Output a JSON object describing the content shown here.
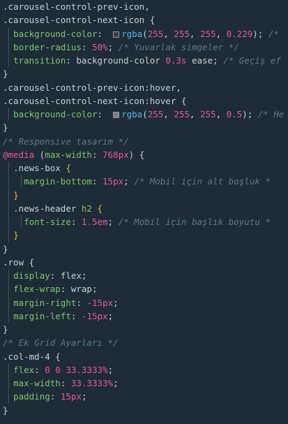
{
  "colors": {
    "background": "#1d2c36",
    "selector": "#c8d3d9",
    "property": "#7fc76f",
    "number": "#e9589a",
    "function": "#52b4e6",
    "brace": "#e3bf3d",
    "comment": "#5f7a87"
  },
  "lines": [
    {
      "t": [
        {
          "k": "sel",
          "v": ".carousel-control-prev-icon,"
        }
      ]
    },
    {
      "t": [
        {
          "k": "sel",
          "v": ".carousel-control-next-icon "
        },
        {
          "k": "punct",
          "v": "{"
        }
      ]
    },
    {
      "i": 1,
      "t": [
        {
          "k": "prop",
          "v": "background-color"
        },
        {
          "k": "punct",
          "v": ":  "
        },
        {
          "k": "swatch",
          "c": "#3a3e42"
        },
        {
          "k": "fn",
          "v": "rgba"
        },
        {
          "k": "punct",
          "v": "("
        },
        {
          "k": "num",
          "v": "255"
        },
        {
          "k": "punct",
          "v": ", "
        },
        {
          "k": "num",
          "v": "255"
        },
        {
          "k": "punct",
          "v": ", "
        },
        {
          "k": "num",
          "v": "255"
        },
        {
          "k": "punct",
          "v": ", "
        },
        {
          "k": "num",
          "v": "0.229"
        },
        {
          "k": "punct",
          "v": "); "
        },
        {
          "k": "cm",
          "v": "/* "
        }
      ]
    },
    {
      "i": 1,
      "t": [
        {
          "k": "prop",
          "v": "border-radius"
        },
        {
          "k": "punct",
          "v": ": "
        },
        {
          "k": "num",
          "v": "50"
        },
        {
          "k": "unit",
          "v": "%"
        },
        {
          "k": "punct",
          "v": "; "
        },
        {
          "k": "cm",
          "v": "/* Yuvarlak simgeler */"
        }
      ]
    },
    {
      "i": 1,
      "t": [
        {
          "k": "prop",
          "v": "transition"
        },
        {
          "k": "punct",
          "v": ": "
        },
        {
          "k": "text",
          "v": "background-color "
        },
        {
          "k": "num",
          "v": "0.3"
        },
        {
          "k": "unit",
          "v": "s"
        },
        {
          "k": "text",
          "v": " ease"
        },
        {
          "k": "punct",
          "v": "; "
        },
        {
          "k": "cm",
          "v": "/* Geçiş ef"
        }
      ]
    },
    {
      "t": [
        {
          "k": "punct",
          "v": "}"
        }
      ]
    },
    {
      "t": [
        {
          "k": "sel",
          "v": ".carousel-control-prev-icon:hover,"
        }
      ]
    },
    {
      "t": [
        {
          "k": "sel",
          "v": ".carousel-control-next-icon:hover "
        },
        {
          "k": "punct",
          "v": "{"
        }
      ]
    },
    {
      "i": 1,
      "t": [
        {
          "k": "prop",
          "v": "background-color"
        },
        {
          "k": "punct",
          "v": ":  "
        },
        {
          "k": "swatch",
          "c": "#7d8084"
        },
        {
          "k": "fn",
          "v": "rgba"
        },
        {
          "k": "punct",
          "v": "("
        },
        {
          "k": "num",
          "v": "255"
        },
        {
          "k": "punct",
          "v": ", "
        },
        {
          "k": "num",
          "v": "255"
        },
        {
          "k": "punct",
          "v": ", "
        },
        {
          "k": "num",
          "v": "255"
        },
        {
          "k": "punct",
          "v": ", "
        },
        {
          "k": "num",
          "v": "0.5"
        },
        {
          "k": "punct",
          "v": "); "
        },
        {
          "k": "cm",
          "v": "/* He"
        }
      ]
    },
    {
      "t": [
        {
          "k": "punct",
          "v": "}"
        }
      ]
    },
    {
      "t": [
        {
          "k": "cm",
          "v": "/* Responsive tasarım */"
        }
      ]
    },
    {
      "t": [
        {
          "k": "at",
          "v": "@media"
        },
        {
          "k": "punct",
          "v": " ("
        },
        {
          "k": "prop",
          "v": "max-width"
        },
        {
          "k": "punct",
          "v": ": "
        },
        {
          "k": "num",
          "v": "768"
        },
        {
          "k": "unit",
          "v": "px"
        },
        {
          "k": "punct",
          "v": ") {"
        }
      ]
    },
    {
      "i": 1,
      "t": [
        {
          "k": "sel",
          "v": ".news-box "
        },
        {
          "k": "brace",
          "v": "{"
        }
      ]
    },
    {
      "i": 2,
      "t": [
        {
          "k": "prop",
          "v": "margin-bottom"
        },
        {
          "k": "punct",
          "v": ": "
        },
        {
          "k": "num",
          "v": "15"
        },
        {
          "k": "unit",
          "v": "px"
        },
        {
          "k": "punct",
          "v": "; "
        },
        {
          "k": "cm",
          "v": "/* Mobil için alt boşluk *"
        }
      ]
    },
    {
      "i": 1,
      "t": [
        {
          "k": "brace",
          "v": "}"
        }
      ]
    },
    {
      "i": 1,
      "t": [
        {
          "k": "sel",
          "v": ".news-header "
        },
        {
          "k": "prop",
          "v": "h2"
        },
        {
          "k": "sel",
          "v": " "
        },
        {
          "k": "brace",
          "v": "{"
        }
      ]
    },
    {
      "i": 2,
      "t": [
        {
          "k": "prop",
          "v": "font-size"
        },
        {
          "k": "punct",
          "v": ": "
        },
        {
          "k": "num",
          "v": "1.5"
        },
        {
          "k": "unit",
          "v": "em"
        },
        {
          "k": "punct",
          "v": "; "
        },
        {
          "k": "cm",
          "v": "/* Mobil için başlık boyutu *"
        }
      ]
    },
    {
      "i": 1,
      "t": [
        {
          "k": "brace",
          "v": "}"
        }
      ]
    },
    {
      "t": [
        {
          "k": "punct",
          "v": "}"
        }
      ]
    },
    {
      "t": [
        {
          "k": "sel",
          "v": ".row "
        },
        {
          "k": "punct",
          "v": "{"
        }
      ]
    },
    {
      "i": 1,
      "t": [
        {
          "k": "prop",
          "v": "display"
        },
        {
          "k": "punct",
          "v": ": "
        },
        {
          "k": "text",
          "v": "flex"
        },
        {
          "k": "punct",
          "v": ";"
        }
      ]
    },
    {
      "i": 1,
      "t": [
        {
          "k": "prop",
          "v": "flex-wrap"
        },
        {
          "k": "punct",
          "v": ": "
        },
        {
          "k": "text",
          "v": "wrap"
        },
        {
          "k": "punct",
          "v": ";"
        }
      ]
    },
    {
      "i": 1,
      "t": [
        {
          "k": "prop",
          "v": "margin-right"
        },
        {
          "k": "punct",
          "v": ": "
        },
        {
          "k": "num",
          "v": "-15"
        },
        {
          "k": "unit",
          "v": "px"
        },
        {
          "k": "punct",
          "v": ";"
        }
      ]
    },
    {
      "i": 1,
      "t": [
        {
          "k": "prop",
          "v": "margin-left"
        },
        {
          "k": "punct",
          "v": ": "
        },
        {
          "k": "num",
          "v": "-15"
        },
        {
          "k": "unit",
          "v": "px"
        },
        {
          "k": "punct",
          "v": ";"
        }
      ]
    },
    {
      "t": [
        {
          "k": "punct",
          "v": "}"
        }
      ]
    },
    {
      "t": [
        {
          "k": "cm",
          "v": "/* Ek Grid Ayarları */"
        }
      ]
    },
    {
      "t": [
        {
          "k": "sel",
          "v": ".col-md-4 "
        },
        {
          "k": "punct",
          "v": "{"
        }
      ]
    },
    {
      "i": 1,
      "t": [
        {
          "k": "prop",
          "v": "flex"
        },
        {
          "k": "punct",
          "v": ": "
        },
        {
          "k": "num",
          "v": "0"
        },
        {
          "k": "punct",
          "v": " "
        },
        {
          "k": "num",
          "v": "0"
        },
        {
          "k": "punct",
          "v": " "
        },
        {
          "k": "num",
          "v": "33.3333"
        },
        {
          "k": "unit",
          "v": "%"
        },
        {
          "k": "punct",
          "v": ";"
        }
      ]
    },
    {
      "i": 1,
      "t": [
        {
          "k": "prop",
          "v": "max-width"
        },
        {
          "k": "punct",
          "v": ": "
        },
        {
          "k": "num",
          "v": "33.3333"
        },
        {
          "k": "unit",
          "v": "%"
        },
        {
          "k": "punct",
          "v": ";"
        }
      ]
    },
    {
      "i": 1,
      "t": [
        {
          "k": "prop",
          "v": "padding"
        },
        {
          "k": "punct",
          "v": ": "
        },
        {
          "k": "num",
          "v": "15"
        },
        {
          "k": "unit",
          "v": "px"
        },
        {
          "k": "punct",
          "v": ";"
        }
      ]
    },
    {
      "t": [
        {
          "k": "punct",
          "v": "}"
        }
      ]
    }
  ]
}
